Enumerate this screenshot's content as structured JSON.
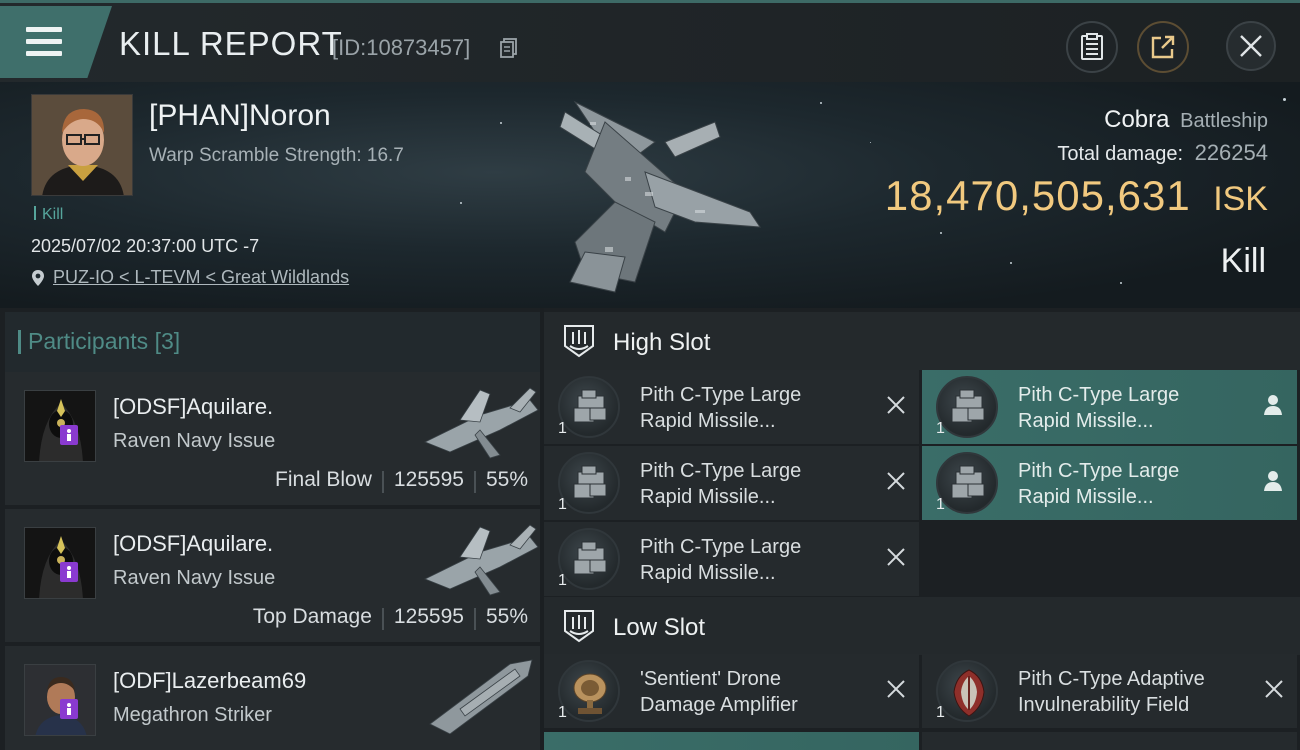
{
  "header": {
    "title": "KILL REPORT",
    "report_id": "[ID:10873457]"
  },
  "victim": {
    "name": "[PHAN]Noron",
    "warp_scramble": "Warp Scramble Strength: 16.7",
    "tag": "Kill",
    "datetime": "2025/07/02 20:37:00 UTC -7",
    "location": "PUZ-IO < L-TEVM < Great Wildlands",
    "ship_name": "Cobra",
    "ship_class": "Battleship",
    "total_damage_label": "Total damage:",
    "total_damage": "226254",
    "isk_value": "18,470,505,631",
    "isk_unit": "ISK",
    "result": "Kill"
  },
  "participants": {
    "label": "Participants",
    "count": "[3]",
    "items": [
      {
        "name": "[ODSF]Aquilare.",
        "ship": "Raven Navy Issue",
        "role": "Final Blow",
        "damage": "125595",
        "percent": "55%"
      },
      {
        "name": "[ODSF]Aquilare.",
        "ship": "Raven Navy Issue",
        "role": "Top Damage",
        "damage": "125595",
        "percent": "55%"
      },
      {
        "name": "[ODF]Lazerbeam69",
        "ship": "Megathron Striker"
      }
    ]
  },
  "slots": {
    "high": {
      "title": "High Slot",
      "modules": [
        {
          "name": "Pith C-Type Large\nRapid Missile...",
          "qty": "1",
          "state": "destroyed"
        },
        {
          "name": "Pith C-Type Large\nRapid Missile...",
          "qty": "1",
          "state": "dropped"
        },
        {
          "name": "Pith C-Type Large\nRapid Missile...",
          "qty": "1",
          "state": "destroyed"
        },
        {
          "name": "Pith C-Type Large\nRapid Missile...",
          "qty": "1",
          "state": "dropped"
        },
        {
          "name": "Pith C-Type Large\nRapid Missile...",
          "qty": "1",
          "state": "destroyed"
        }
      ]
    },
    "low": {
      "title": "Low Slot",
      "modules": [
        {
          "name": "'Sentient' Drone\nDamage Amplifier",
          "qty": "1",
          "state": "destroyed"
        },
        {
          "name": "Pith C-Type Adaptive\nInvulnerability Field",
          "qty": "1",
          "state": "destroyed"
        }
      ]
    }
  },
  "colors": {
    "accent": "#3f6f6b",
    "isk": "#f1c97f",
    "dropped_row": "#3a6d68",
    "corp_badge": "#8a3ad0"
  },
  "icons": {
    "menu": "hamburger-icon",
    "copy": "copy-icon",
    "clipboard": "clipboard-icon",
    "share": "share-icon",
    "close": "close-icon",
    "location": "location-pin-icon",
    "slot": "slot-shield-icon",
    "destroyed": "x-icon",
    "dropped": "person-icon"
  }
}
